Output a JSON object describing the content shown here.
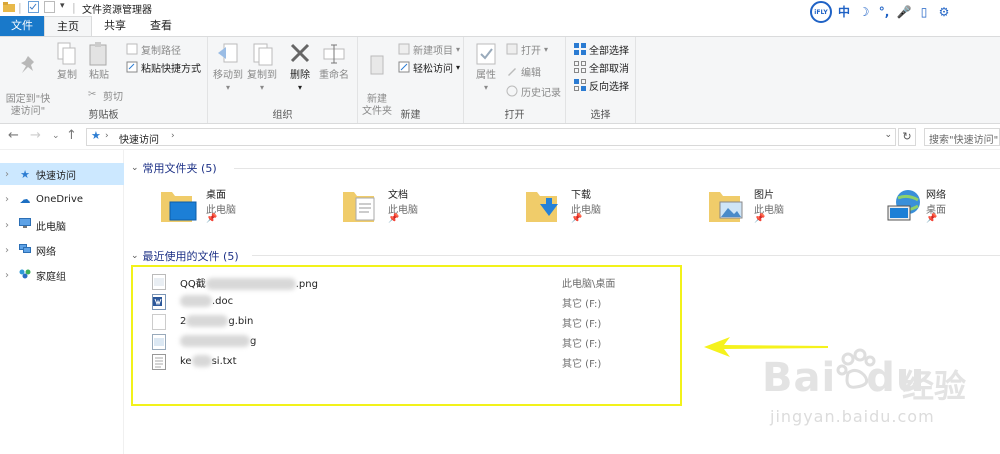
{
  "window": {
    "title": "文件资源管理器"
  },
  "ifly": {
    "logo": "iFLY",
    "buttons": [
      "中",
      "☽",
      "°,",
      "🎤",
      "▯",
      "⚙"
    ]
  },
  "tabs": [
    {
      "label": "文件"
    },
    {
      "label": "主页"
    },
    {
      "label": "共享"
    },
    {
      "label": "查看"
    }
  ],
  "ribbon": {
    "clipboard": {
      "label": "剪贴板",
      "pin": "固定到\"快\n速访问\"",
      "copy": "复制",
      "paste": "粘贴",
      "copy_path": "复制路径",
      "paste_shortcut": "粘贴快捷方式",
      "cut": "剪切"
    },
    "organize": {
      "label": "组织",
      "move_to": "移动到",
      "copy_to": "复制到",
      "delete": "删除",
      "rename": "重命名"
    },
    "new": {
      "label": "新建",
      "new_folder": "新建\n文件夹",
      "new_item": "新建项目",
      "easy_access": "轻松访问"
    },
    "open": {
      "label": "打开",
      "properties": "属性",
      "open": "打开",
      "edit": "编辑",
      "history": "历史记录"
    },
    "select": {
      "label": "选择",
      "select_all": "全部选择",
      "select_none": "全部取消",
      "invert": "反向选择"
    }
  },
  "address": {
    "crumb": "快速访问",
    "search_placeholder": "搜索\"快速访问\""
  },
  "sidebar": {
    "items": [
      {
        "label": "快速访问",
        "icon": "star-icon"
      },
      {
        "label": "OneDrive",
        "icon": "cloud-icon"
      },
      {
        "label": "此电脑",
        "icon": "computer-icon"
      },
      {
        "label": "网络",
        "icon": "network-icon"
      },
      {
        "label": "家庭组",
        "icon": "homegroup-icon"
      }
    ]
  },
  "frequent": {
    "title": "常用文件夹 (5)",
    "folders": [
      {
        "name": "桌面",
        "location": "此电脑",
        "icon": "desktop-folder-icon"
      },
      {
        "name": "文档",
        "location": "此电脑",
        "icon": "documents-folder-icon"
      },
      {
        "name": "下载",
        "location": "此电脑",
        "icon": "downloads-folder-icon"
      },
      {
        "name": "图片",
        "location": "此电脑",
        "icon": "pictures-folder-icon"
      },
      {
        "name": "网络",
        "location": "桌面",
        "icon": "network-globe-icon"
      }
    ]
  },
  "recent": {
    "title": "最近使用的文件 (5)",
    "files": [
      {
        "prefix": "QQ截",
        "suffix": ".png",
        "location": "此电脑\\桌面",
        "icon": "image-file-icon"
      },
      {
        "prefix": "",
        "suffix": ".doc",
        "location": "其它 (F:)",
        "icon": "doc-file-icon"
      },
      {
        "prefix": "2",
        "suffix": "g.bin",
        "location": "其它 (F:)",
        "icon": "blank-file-icon"
      },
      {
        "prefix": "",
        "suffix": "g",
        "location": "其它 (F:)",
        "icon": "image-file-icon"
      },
      {
        "prefix": "ke",
        "suffix": "si.txt",
        "location": "其它 (F:)",
        "icon": "text-file-icon"
      }
    ]
  },
  "watermark": {
    "brand": "Bai",
    "brand2": "du",
    "cn": "经验",
    "url": "jingyan.baidu.com"
  },
  "colors": {
    "accent": "#1979ca",
    "highlight": "#f2f21a",
    "section_title": "#1e3287",
    "selection": "#cce8ff"
  }
}
